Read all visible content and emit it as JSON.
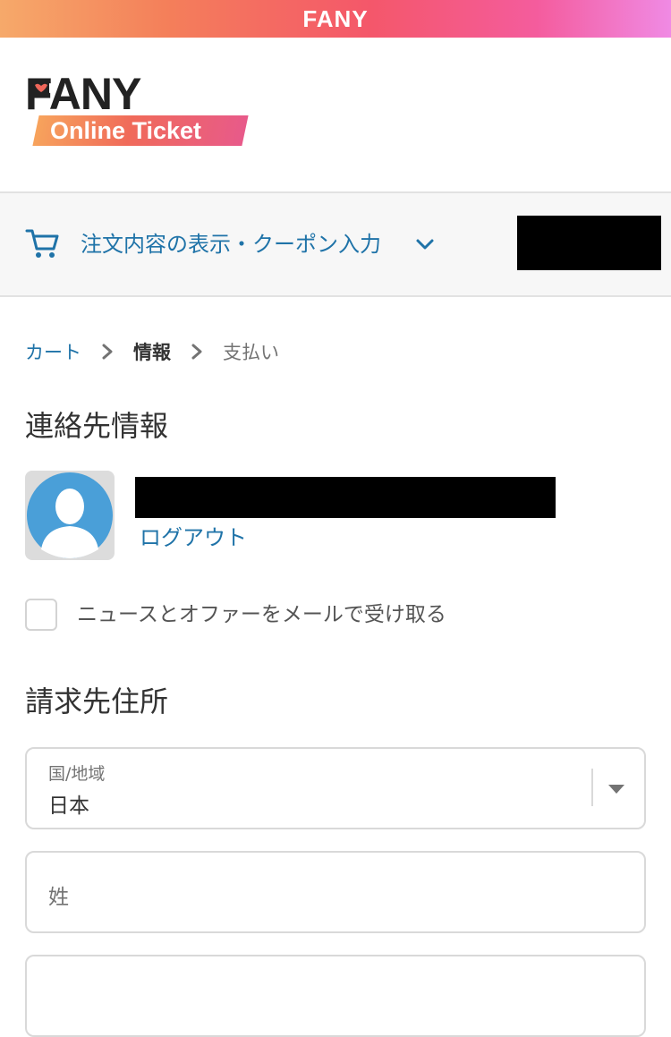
{
  "topbar": {
    "brand": "FANY"
  },
  "header": {
    "logo_main": "FANY",
    "logo_sub": "Online Ticket"
  },
  "summary": {
    "cart_icon": "cart-icon",
    "label": "注文内容の表示・クーポン入力",
    "chevron_icon": "chevron-down-icon"
  },
  "breadcrumb": {
    "items": [
      {
        "label": "カート"
      },
      {
        "label": "情報"
      },
      {
        "label": "支払い"
      }
    ],
    "separator_icon": "chevron-right-icon"
  },
  "contact": {
    "title": "連絡先情報",
    "logout_label": "ログアウト",
    "newsletter_label": "ニュースとオファーをメールで受け取る",
    "newsletter_checked": false
  },
  "billing": {
    "title": "請求先住所",
    "country": {
      "label": "国/地域",
      "value": "日本"
    },
    "last_name": {
      "placeholder": "姓"
    }
  },
  "colors": {
    "link": "#1f73a8",
    "text": "#333333",
    "muted": "#737373",
    "border": "#d9d9d9",
    "avatar_blue": "#4a9fd8"
  }
}
